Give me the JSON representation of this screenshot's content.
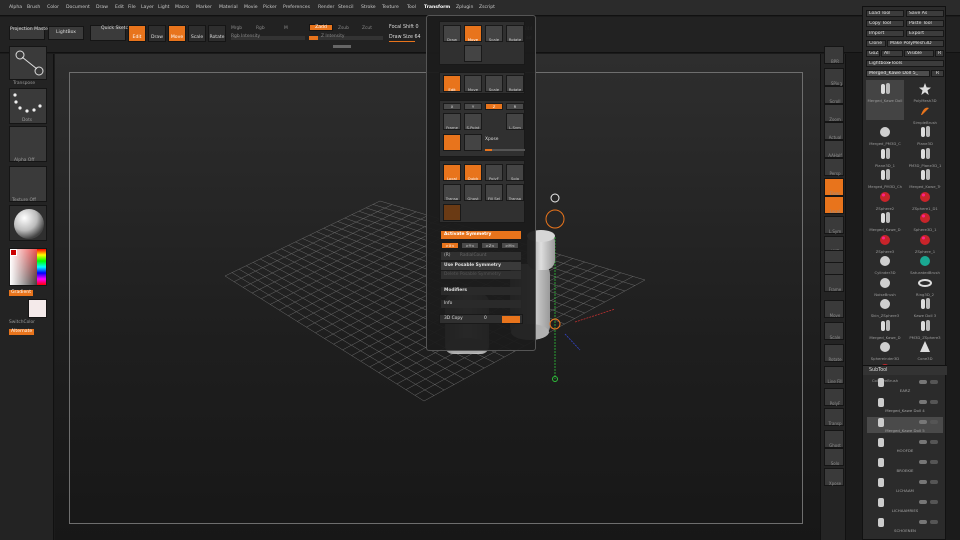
{
  "menu": [
    "Alpha",
    "Brush",
    "Color",
    "Document",
    "Draw",
    "Edit",
    "File",
    "Layer",
    "Light",
    "Macro",
    "Marker",
    "Material",
    "Movie",
    "Picker",
    "Preferences",
    "Render",
    "Stencil",
    "Stroke",
    "Texture",
    "Tool",
    "Transform",
    "Zplugin",
    "Zscript"
  ],
  "menu_active": "Transform",
  "shelf": {
    "projection_master": "Projection Master",
    "lightbox": "LightBox",
    "quick_sketch": "Quick Sketch",
    "edit": "Edit",
    "draw": "Draw",
    "move": "Move",
    "scale": "Scale",
    "rotate": "Rotate",
    "mrgb": "Mrgb",
    "rgb": "Rgb",
    "m": "M",
    "zadd": "Zadd",
    "zsub": "Zsub",
    "zcut": "Zcut",
    "rgb_intensity": "Rgb Intensity",
    "z_intensity": "Z Intensity",
    "focal_shift": "Focal Shift",
    "focal_shift_value": "0",
    "draw_size": "Draw Size",
    "draw_size_value": "64",
    "active_points_value": "244",
    "total_points_label": "ad"
  },
  "left": {
    "brush_label": "Transpose",
    "stroke_label": "Dots",
    "alpha_label": "Alpha Off",
    "texture_label": "Texture Off",
    "gradient": "Gradient",
    "switch_color": "SwitchColor",
    "alternate": "Alternate"
  },
  "rightshelf": [
    "BPR",
    "SPix",
    "Scroll",
    "Zoom",
    "Actual",
    "AAHalf",
    "Persp",
    "Floor",
    "Local",
    "L.Sym",
    "XYZ",
    "",
    "",
    "Frame",
    "Move",
    "Scale",
    "Rotate",
    "Line Fill",
    "PolyF",
    "Transp",
    "Ghost",
    "Solo",
    "Xpose"
  ],
  "rightshelf_spix_value": "3",
  "tool": {
    "load_tool": "Load Tool",
    "save_as": "Save As",
    "copy_tool": "Copy Tool",
    "paste_tool": "Paste Tool",
    "import": "Import",
    "export": "Export",
    "clone": "Clone",
    "make_polymesh": "Make PolyMesh3D",
    "goz": "GoZ",
    "all": "All",
    "visible": "Visible",
    "r": "R",
    "lightbox_tools": "Lightbox▸Tools",
    "current_tool": "Merged_Kawe Doll 5_",
    "current_tool_count": "R",
    "grid": [
      {
        "name": "Merged_Kawe Doll",
        "kind": "doll"
      },
      {
        "name": "PolyMesh3D",
        "kind": "star"
      },
      {
        "name": "",
        "kind": "blank"
      },
      {
        "name": "SimpleBrush",
        "kind": "simple"
      },
      {
        "name": "Merged_PM3D_C",
        "kind": "grey"
      },
      {
        "name": "Plane3D",
        "kind": "doll"
      },
      {
        "name": "Plane3D_1",
        "kind": "doll"
      },
      {
        "name": "PM3D_Plane3D_1",
        "kind": "doll"
      },
      {
        "name": "Merged_PM3D_Ch",
        "kind": "doll"
      },
      {
        "name": "Merged_Kawe_Tr",
        "kind": "doll"
      },
      {
        "name": "ZSphere2",
        "kind": "red"
      },
      {
        "name": "ZSphere1_D1",
        "kind": "red"
      },
      {
        "name": "Merged_Kawe_D",
        "kind": "doll"
      },
      {
        "name": "Sphere3D_1",
        "kind": "red"
      },
      {
        "name": "ZSphere3",
        "kind": "red"
      },
      {
        "name": "ZSphere_1",
        "kind": "red"
      },
      {
        "name": "Cylinder3D",
        "kind": "grey"
      },
      {
        "name": "SaturatedBrush",
        "kind": "teal"
      },
      {
        "name": "NoiseBrush",
        "kind": "grey"
      },
      {
        "name": "Ring3D_2",
        "kind": "ring"
      },
      {
        "name": "Skin_ZSphere3",
        "kind": "grey"
      },
      {
        "name": "Kawe Doll 3",
        "kind": "doll"
      },
      {
        "name": "Merged_Kawe_D",
        "kind": "doll"
      },
      {
        "name": "PM3D_ZSphere3",
        "kind": "doll"
      },
      {
        "name": "Sphereinder3D",
        "kind": "grey"
      },
      {
        "name": "Cone3D",
        "kind": "cone"
      },
      {
        "name": "ColorizeBrush",
        "kind": "red"
      }
    ],
    "subtool_header": "SubTool",
    "subtools": [
      "EARZ",
      "Merged_Kawe Doll 4",
      "Merged_Kawe Doll 5",
      "HOOFDE",
      "BROEKIE",
      "LICHAAM",
      "LICHAAMRIES",
      "SCHOENEN"
    ]
  },
  "transform": {
    "top_icons": [
      "Draw",
      "Move",
      "Scale",
      "Rotate"
    ],
    "quick_icons": [
      "Edit",
      "Move",
      "Scale",
      "Rotate"
    ],
    "sym_buttons": [
      "X",
      "Y",
      "Z",
      "R"
    ],
    "row_icons": [
      "Frame",
      "S.Point",
      "L.Sym",
      "",
      "Xpose",
      ""
    ],
    "vis_icons": [
      "Local",
      "Quick",
      "PolyF",
      "Solo",
      "Transp",
      "Ghost",
      "Fill Sel",
      "Transp"
    ],
    "activate_symmetry": "Activate Symmetry",
    "axis_x": ">X<",
    "axis_y": ">Y<",
    "axis_z": ">Z<",
    "axis_m": ">M<",
    "radial": "(R)",
    "radial_count": "RadialCount",
    "use_posable": "Use Posable Symmetry",
    "delete_posable": "Delete Posable Symmetry",
    "modifiers": "Modifiers",
    "info": "Info",
    "copy3d": "3D Copy",
    "copy3d_value": "0"
  }
}
